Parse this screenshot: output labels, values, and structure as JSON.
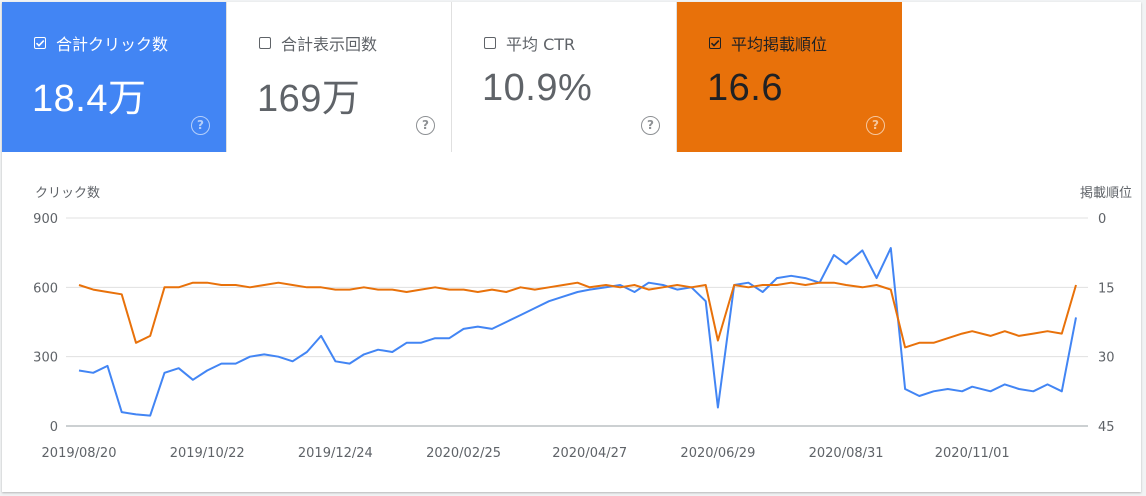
{
  "metrics": [
    {
      "label": "合計クリック数",
      "value": "18.4万",
      "checked": true,
      "color": "#4285f4"
    },
    {
      "label": "合計表示回数",
      "value": "169万",
      "checked": false,
      "color": "#5e35b1"
    },
    {
      "label": "平均 CTR",
      "value": "10.9%",
      "checked": false,
      "color": "#00897b"
    },
    {
      "label": "平均掲載順位",
      "value": "16.6",
      "checked": true,
      "color": "#e8710a"
    }
  ],
  "help_glyph": "?",
  "chart_data": {
    "type": "line",
    "ylabel": "クリック数",
    "y2label": "掲載順位",
    "ylim": [
      0,
      900
    ],
    "y2lim": [
      0,
      45
    ],
    "y2_inverted": true,
    "yticks": [
      "0",
      "300",
      "600",
      "900"
    ],
    "y2ticks": [
      "45",
      "30",
      "15",
      "0"
    ],
    "xticks": [
      "2019/08/20",
      "2019/10/22",
      "2019/12/24",
      "2020/02/25",
      "2020/04/27",
      "2020/06/29",
      "2020/08/31",
      "2020/11/01"
    ],
    "grid": true,
    "x_dates_weekly": [
      "2019/08/20",
      "2019/08/27",
      "2019/09/03",
      "2019/09/10",
      "2019/09/17",
      "2019/09/24",
      "2019/10/01",
      "2019/10/08",
      "2019/10/15",
      "2019/10/22",
      "2019/10/29",
      "2019/11/05",
      "2019/11/12",
      "2019/11/19",
      "2019/11/26",
      "2019/12/03",
      "2019/12/10",
      "2019/12/17",
      "2019/12/24",
      "2019/12/31",
      "2020/01/07",
      "2020/01/14",
      "2020/01/21",
      "2020/01/28",
      "2020/02/04",
      "2020/02/11",
      "2020/02/18",
      "2020/02/25",
      "2020/03/03",
      "2020/03/10",
      "2020/03/17",
      "2020/03/24",
      "2020/03/31",
      "2020/04/07",
      "2020/04/14",
      "2020/04/21",
      "2020/04/27",
      "2020/05/05",
      "2020/05/12",
      "2020/05/19",
      "2020/05/26",
      "2020/06/02",
      "2020/06/09",
      "2020/06/16",
      "2020/06/23",
      "2020/06/29",
      "2020/07/07",
      "2020/07/14",
      "2020/07/21",
      "2020/07/28",
      "2020/08/04",
      "2020/08/11",
      "2020/08/18",
      "2020/08/25",
      "2020/08/31",
      "2020/09/08",
      "2020/09/15",
      "2020/09/22",
      "2020/09/29",
      "2020/10/06",
      "2020/10/13",
      "2020/10/20",
      "2020/10/27",
      "2020/11/01",
      "2020/11/10",
      "2020/11/17",
      "2020/11/24",
      "2020/12/01",
      "2020/12/08",
      "2020/12/15",
      "2020/12/22"
    ],
    "series": [
      {
        "name": "合計クリック数",
        "axis": "left",
        "color": "#4285f4",
        "values": [
          240,
          230,
          260,
          60,
          50,
          45,
          230,
          250,
          200,
          240,
          270,
          270,
          300,
          310,
          300,
          280,
          320,
          390,
          280,
          270,
          310,
          330,
          320,
          360,
          360,
          380,
          380,
          420,
          430,
          420,
          450,
          480,
          510,
          540,
          560,
          580,
          590,
          600,
          610,
          580,
          620,
          610,
          590,
          600,
          540,
          80,
          610,
          620,
          580,
          640,
          650,
          640,
          620,
          740,
          700,
          760,
          640,
          770,
          160,
          130,
          150,
          160,
          150,
          170,
          150,
          180,
          160,
          150,
          180,
          150,
          470
        ]
      },
      {
        "name": "平均掲載順位",
        "axis": "right",
        "color": "#e8710a",
        "values": [
          14.5,
          15.5,
          16.0,
          16.5,
          27.0,
          25.5,
          15.0,
          15.0,
          14.0,
          14.0,
          14.5,
          14.5,
          15.0,
          14.5,
          14.0,
          14.5,
          15.0,
          15.0,
          15.5,
          15.5,
          15.0,
          15.5,
          15.5,
          16.0,
          15.5,
          15.0,
          15.5,
          15.5,
          16.0,
          15.5,
          16.0,
          15.0,
          15.5,
          15.0,
          14.5,
          14.0,
          15.0,
          14.5,
          15.0,
          14.5,
          15.5,
          15.0,
          14.5,
          15.0,
          14.5,
          26.5,
          14.5,
          15.0,
          14.5,
          14.5,
          14.0,
          14.5,
          14.0,
          14.0,
          14.5,
          15.0,
          14.5,
          15.5,
          28.0,
          27.0,
          27.0,
          26.0,
          25.0,
          24.5,
          25.5,
          24.5,
          25.5,
          25.0,
          24.5,
          25.0,
          14.5
        ]
      }
    ]
  }
}
